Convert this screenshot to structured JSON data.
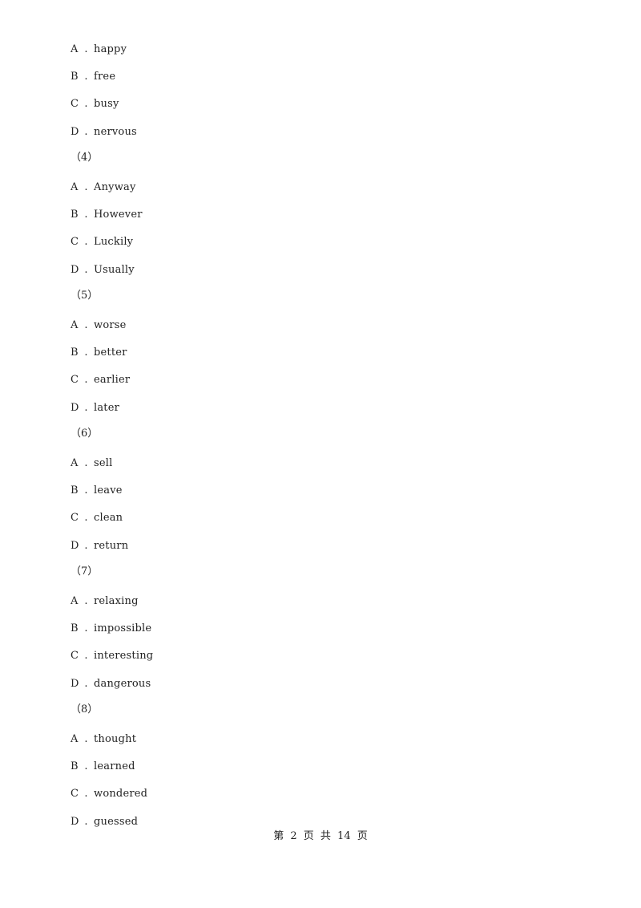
{
  "questions": [
    {
      "number": "",
      "options": [
        {
          "letter": "A",
          "text": "happy"
        },
        {
          "letter": "B",
          "text": "free"
        },
        {
          "letter": "C",
          "text": "busy"
        },
        {
          "letter": "D",
          "text": "nervous"
        }
      ]
    },
    {
      "number": "（4）",
      "options": [
        {
          "letter": "A",
          "text": "Anyway"
        },
        {
          "letter": "B",
          "text": "However"
        },
        {
          "letter": "C",
          "text": "Luckily"
        },
        {
          "letter": "D",
          "text": "Usually"
        }
      ]
    },
    {
      "number": "（5）",
      "options": [
        {
          "letter": "A",
          "text": "worse"
        },
        {
          "letter": "B",
          "text": "better"
        },
        {
          "letter": "C",
          "text": "earlier"
        },
        {
          "letter": "D",
          "text": "later"
        }
      ]
    },
    {
      "number": "（6）",
      "options": [
        {
          "letter": "A",
          "text": "sell"
        },
        {
          "letter": "B",
          "text": "leave"
        },
        {
          "letter": "C",
          "text": "clean"
        },
        {
          "letter": "D",
          "text": "return"
        }
      ]
    },
    {
      "number": "（7）",
      "options": [
        {
          "letter": "A",
          "text": "relaxing"
        },
        {
          "letter": "B",
          "text": "impossible"
        },
        {
          "letter": "C",
          "text": "interesting"
        },
        {
          "letter": "D",
          "text": "dangerous"
        }
      ]
    },
    {
      "number": "（8）",
      "options": [
        {
          "letter": "A",
          "text": "thought"
        },
        {
          "letter": "B",
          "text": "learned"
        },
        {
          "letter": "C",
          "text": "wondered"
        },
        {
          "letter": "D",
          "text": "guessed"
        }
      ]
    }
  ],
  "separator": ".",
  "footer": {
    "text": "第 2 页 共 14 页"
  }
}
